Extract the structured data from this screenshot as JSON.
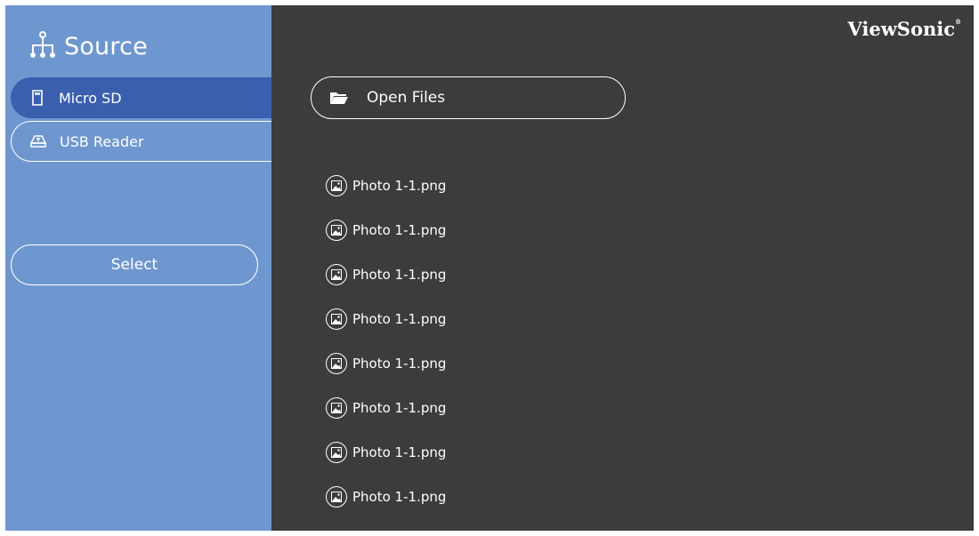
{
  "sidebar": {
    "title": "Source",
    "title_icon": "source-tree-icon",
    "items": [
      {
        "label": "Micro SD",
        "icon": "sd-card-icon",
        "active": true
      },
      {
        "label": "USB Reader",
        "icon": "usb-drive-icon",
        "active": false
      }
    ],
    "select_label": "Select"
  },
  "header": {
    "brand": "ViewSonic",
    "brand_mark": "®"
  },
  "main": {
    "open_files_label": "Open Files",
    "open_files_icon": "folder-icon",
    "files": [
      {
        "name": "Photo 1-1.png",
        "icon": "image-icon"
      },
      {
        "name": "Photo 1-1.png",
        "icon": "image-icon"
      },
      {
        "name": "Photo 1-1.png",
        "icon": "image-icon"
      },
      {
        "name": "Photo 1-1.png",
        "icon": "image-icon"
      },
      {
        "name": "Photo 1-1.png",
        "icon": "image-icon"
      },
      {
        "name": "Photo 1-1.png",
        "icon": "image-icon"
      },
      {
        "name": "Photo 1-1.png",
        "icon": "image-icon"
      },
      {
        "name": "Photo 1-1.png",
        "icon": "image-icon"
      }
    ]
  },
  "colors": {
    "sidebar_bg": "#6f97cf",
    "active_item_bg": "#3a5fae",
    "main_bg": "#3c3c3c",
    "text": "#ffffff"
  }
}
